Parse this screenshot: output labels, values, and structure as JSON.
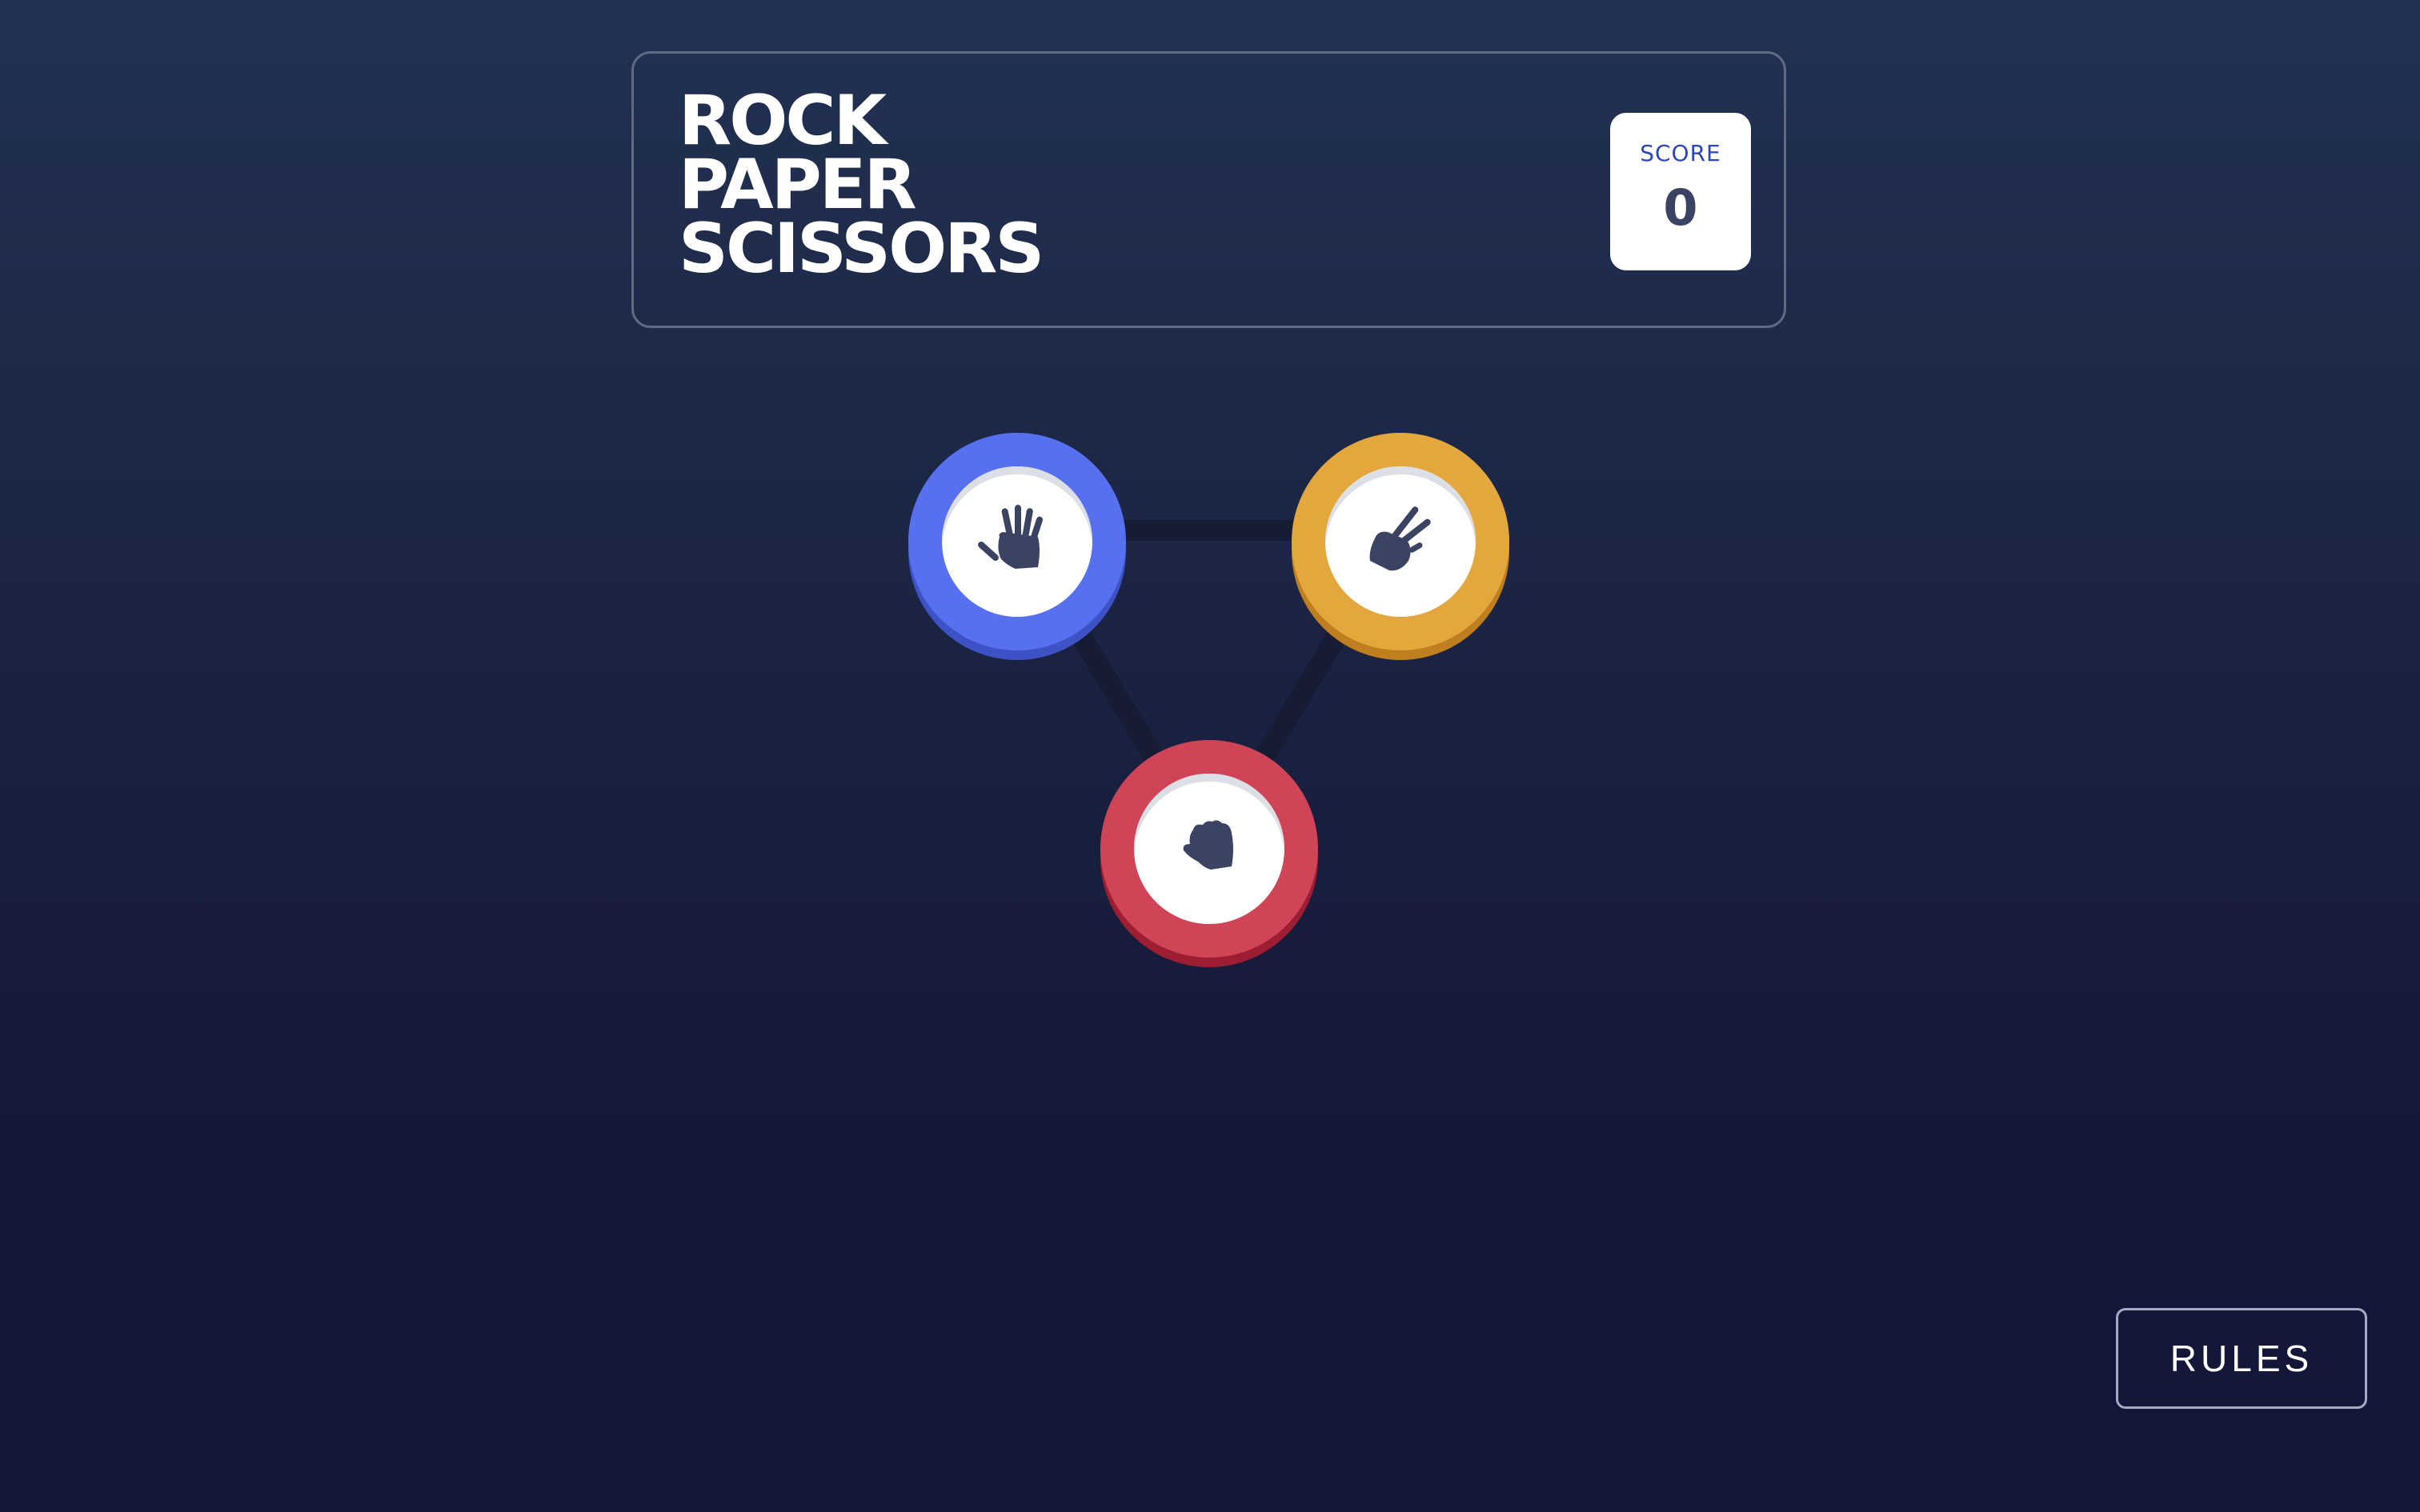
{
  "header": {
    "title_lines": [
      "ROCK",
      "PAPER",
      "SCISSORS"
    ],
    "score": {
      "label": "SCORE",
      "value": "0"
    }
  },
  "choices": [
    {
      "name": "paper",
      "icon": "paper-hand-icon",
      "color": "#5670ef"
    },
    {
      "name": "scissors",
      "icon": "scissors-hand-icon",
      "color": "#e3a73e"
    },
    {
      "name": "rock",
      "icon": "rock-fist-icon",
      "color": "#d04457"
    }
  ],
  "footer": {
    "rules_label": "RULES"
  },
  "colors": {
    "background_top": "#223152",
    "background_bottom": "#14163a",
    "score_label": "#2a46c0",
    "score_value": "#3b4363"
  }
}
